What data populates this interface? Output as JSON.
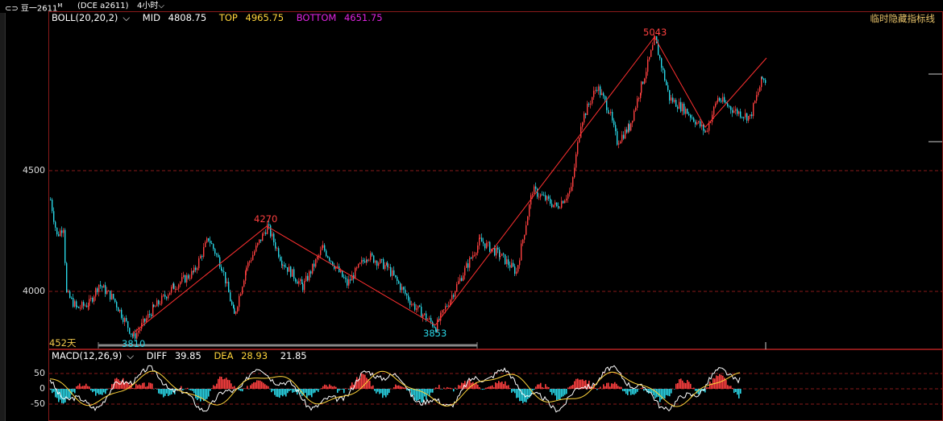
{
  "topbar": {
    "symbol": "⊂⊃ 豆一2611",
    "symbol_sup": "M",
    "exchange": "(DCE a2611)",
    "period": "4小时"
  },
  "indicator_bar": {
    "boll_name": "BOLL(20,20,2)",
    "mid_label": "MID",
    "mid_value": "4808.75",
    "top_label": "TOP",
    "top_value": "4965.75",
    "bottom_label": "BOTTOM",
    "bottom_value": "4651.75",
    "hide_indicator_btn": "临时隐藏指标线"
  },
  "main_chart": {
    "y_ticks": [
      "4500",
      "4000"
    ],
    "peaks": {
      "p1": "4270",
      "p2": "5043"
    },
    "troughs": {
      "t1": "3810",
      "t2": "3853"
    },
    "day_count": "452天"
  },
  "macd_bar": {
    "name": "MACD(12,26,9)",
    "diff_label": "DIFF",
    "diff_value": "39.85",
    "dea_label": "DEA",
    "dea_value": "28.93",
    "macd_value": "21.85",
    "y_ticks": [
      "50",
      "0",
      "-50"
    ]
  },
  "colors": {
    "up": "#ff4040",
    "down": "#2ad6e6",
    "boll_mid": "#ffffff",
    "boll_top": "#ffd43b",
    "boll_bottom": "#e024e0",
    "grid": "#8a1a1a"
  }
}
